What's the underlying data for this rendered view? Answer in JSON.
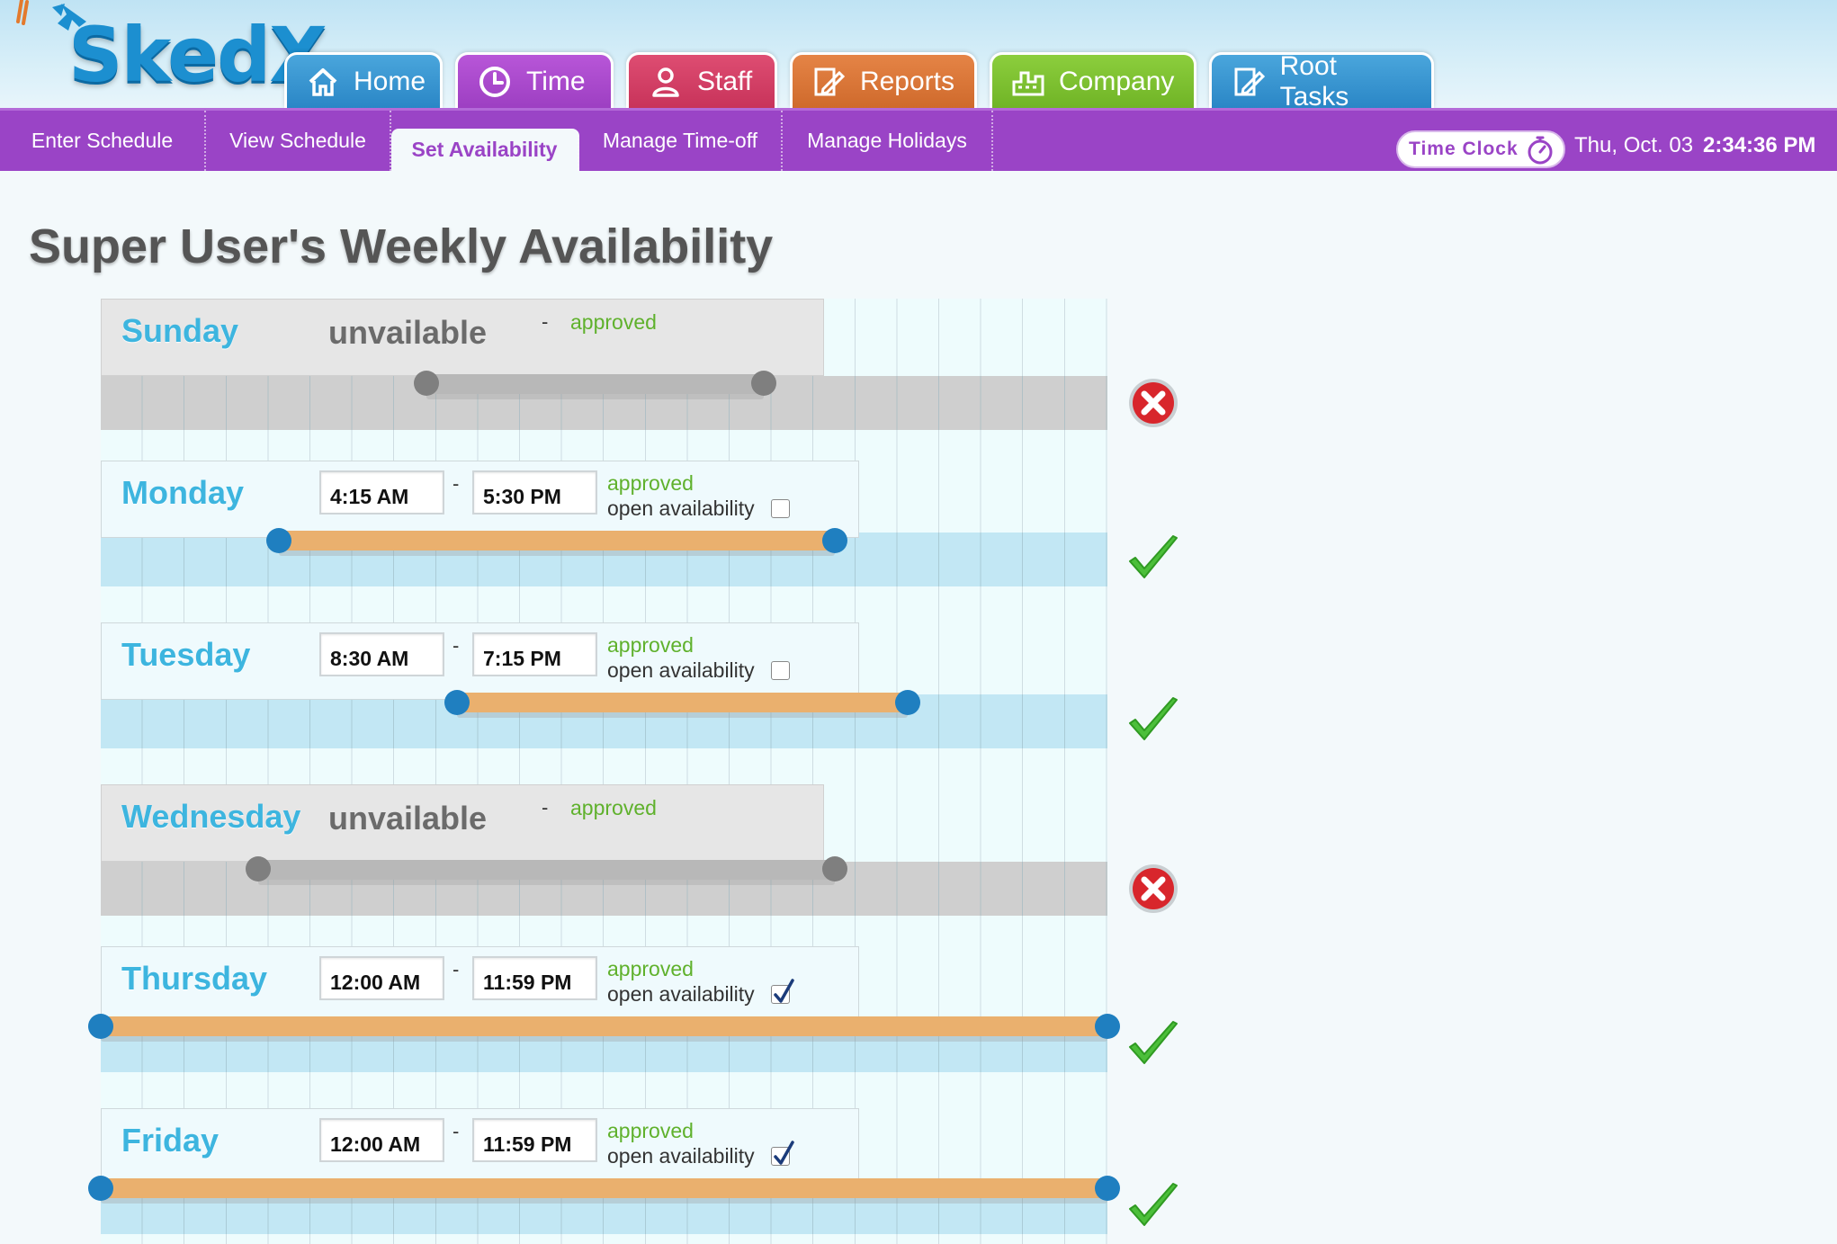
{
  "app": {
    "name": "SkedX",
    "brand_color": "#1c8fd0"
  },
  "main_tabs": [
    {
      "label": "Home",
      "icon": "home-icon",
      "color": "#3a96d2"
    },
    {
      "label": "Time",
      "icon": "clock-icon",
      "color": "#a94bcf",
      "active": true
    },
    {
      "label": "Staff",
      "icon": "person-icon",
      "color": "#d33f66"
    },
    {
      "label": "Reports",
      "icon": "document-edit-icon",
      "color": "#da7638"
    },
    {
      "label": "Company",
      "icon": "building-icon",
      "color": "#7ec231"
    },
    {
      "label": "Root Tasks",
      "icon": "document-edit-icon",
      "color": "#3a96d2"
    }
  ],
  "subnav": {
    "items": [
      {
        "label": "Enter Schedule"
      },
      {
        "label": "View Schedule"
      },
      {
        "label": "Set Availability",
        "active": true
      },
      {
        "label": "Manage Time-off"
      },
      {
        "label": "Manage Holidays"
      }
    ],
    "time_clock_label": "Time Clock",
    "date": "Thu, Oct. 03",
    "time": "2:34:36 PM"
  },
  "page_title": "Super User's Weekly Availability",
  "days": [
    {
      "name": "Sunday",
      "available": false,
      "unavailable_label": "unvailable",
      "dash": "-",
      "status": "approved",
      "range_fraction": [
        0.3237,
        0.6582
      ]
    },
    {
      "name": "Monday",
      "available": true,
      "start": "4:15 AM",
      "end": "5:30 PM",
      "dash": "-",
      "status": "approved",
      "open_label": "open availability",
      "open_checked": false,
      "range_fraction": [
        0.1771,
        0.7291
      ]
    },
    {
      "name": "Tuesday",
      "available": true,
      "start": "8:30 AM",
      "end": "7:15 PM",
      "dash": "-",
      "status": "approved",
      "open_label": "open availability",
      "open_checked": false,
      "range_fraction": [
        0.3541,
        0.802
      ]
    },
    {
      "name": "Wednesday",
      "available": false,
      "unavailable_label": "unvailable",
      "dash": "-",
      "status": "approved",
      "range_fraction": [
        0.1563,
        0.7291
      ]
    },
    {
      "name": "Thursday",
      "available": true,
      "start": "12:00 AM",
      "end": "11:59 PM",
      "dash": "-",
      "status": "approved",
      "open_label": "open availability",
      "open_checked": true,
      "range_fraction": [
        0.0,
        1.0
      ]
    },
    {
      "name": "Friday",
      "available": true,
      "start": "12:00 AM",
      "end": "11:59 PM",
      "dash": "-",
      "status": "approved",
      "open_label": "open availability",
      "open_checked": true,
      "range_fraction": [
        0.0,
        1.0
      ]
    }
  ],
  "colors": {
    "available_track": "#eab06e",
    "available_handle": "#1f7fc0",
    "unavailable_track": "#b8b8b8",
    "unavailable_handle": "#7f7f7f",
    "approved_text": "#5fb12c",
    "day_name": "#3db5df"
  }
}
